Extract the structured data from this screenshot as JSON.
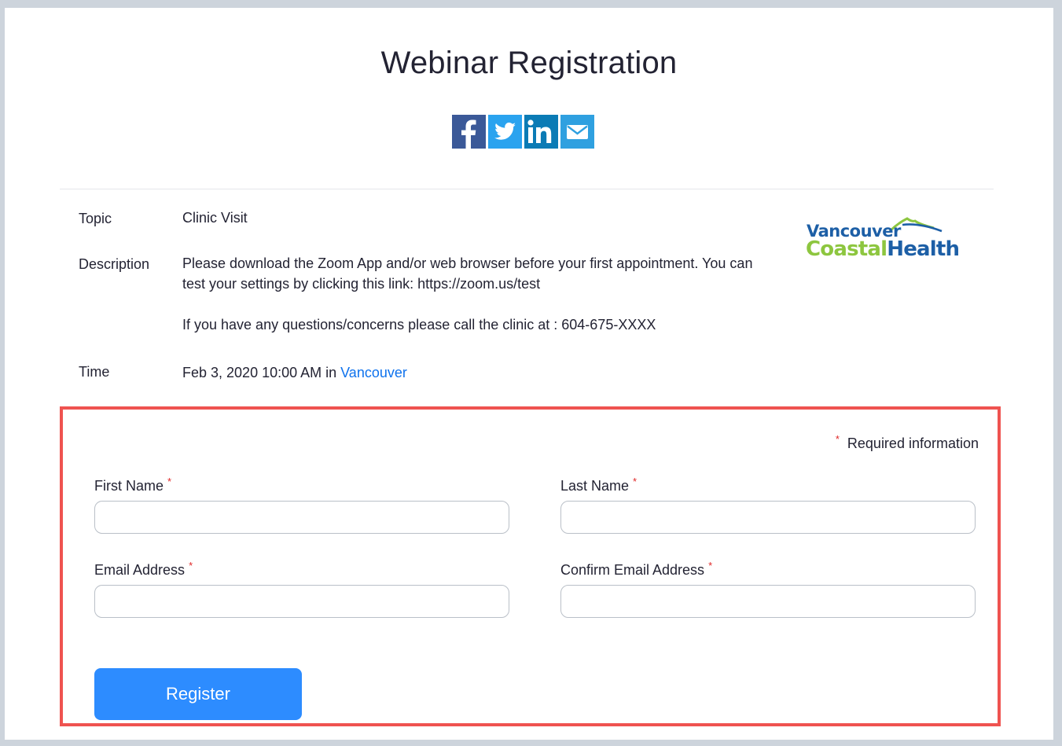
{
  "page": {
    "title": "Webinar Registration"
  },
  "share": {
    "icons": [
      "facebook-icon",
      "twitter-icon",
      "linkedin-icon",
      "email-icon"
    ],
    "colors": {
      "facebook": "#3b5998",
      "twitter": "#2aa3ef",
      "linkedin": "#0b7bb5",
      "email": "#2fa0e0"
    }
  },
  "details": {
    "topic_label": "Topic",
    "topic_value": "Clinic Visit",
    "description_label": "Description",
    "description_p1": "Please download the Zoom App and/or web browser before your first appointment. You can test your settings by clicking this link: https://zoom.us/test",
    "description_p2": "If you have any questions/concerns please call the clinic at : 604-675-XXXX",
    "time_label": "Time",
    "time_value": "Feb 3, 2020 10:00 AM in ",
    "time_zone_link": "Vancouver"
  },
  "logo": {
    "line1": "Vancouver",
    "coastal": "Coastal",
    "health": "Health"
  },
  "form": {
    "required_note": "Required information",
    "first_name_label": "First Name",
    "last_name_label": "Last Name",
    "email_label": "Email Address",
    "confirm_email_label": "Confirm Email Address",
    "first_name_value": "",
    "last_name_value": "",
    "email_value": "",
    "confirm_email_value": "",
    "register_label": "Register"
  },
  "colors": {
    "accent": "#2d8cff",
    "link": "#0e72ed",
    "highlight_border": "#ef5350",
    "required_star": "#e02828"
  }
}
